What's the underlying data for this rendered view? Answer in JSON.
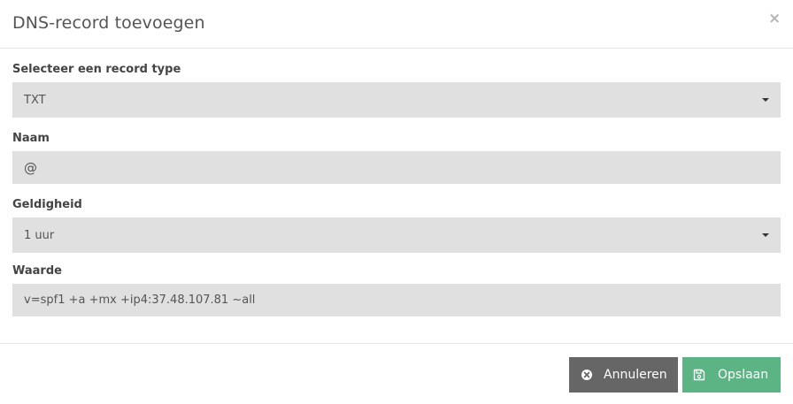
{
  "modal": {
    "title": "DNS-record toevoegen",
    "close_symbol": "×"
  },
  "form": {
    "record_type": {
      "label": "Selecteer een record type",
      "selected": "TXT"
    },
    "name": {
      "label": "Naam",
      "value": "@"
    },
    "ttl": {
      "label": "Geldigheid",
      "selected": "1 uur"
    },
    "value": {
      "label": "Waarde",
      "value": "v=spf1 +a +mx +ip4:37.48.107.81 ~all"
    }
  },
  "footer": {
    "cancel_label": "Annuleren",
    "save_label": "Opslaan"
  },
  "icons": {
    "close": "close-icon",
    "select_caret": "caret-down-icon",
    "cancel": "times-circle-icon",
    "save": "floppy-disk-icon"
  },
  "colors": {
    "field_bg": "#e0e0e0",
    "cancel_button": "#666666",
    "save_button": "#5cb484"
  }
}
